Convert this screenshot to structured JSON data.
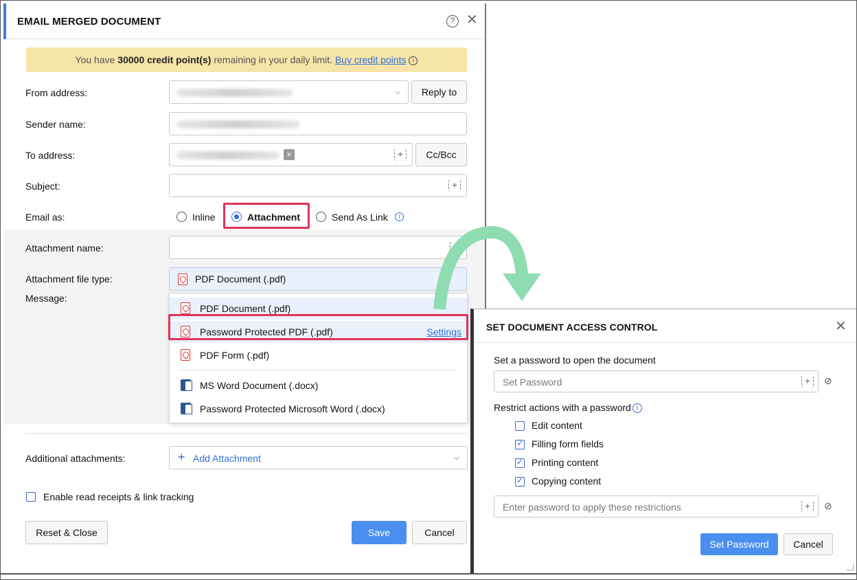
{
  "email_dialog": {
    "title": "EMAIL MERGED DOCUMENT",
    "credit": {
      "prefix": "You have ",
      "amount": "30000 credit point(s)",
      "suffix": " remaining in your daily limit. ",
      "link": "Buy credit points"
    },
    "from_label": "From address:",
    "reply_to": "Reply to",
    "sender_label": "Sender name:",
    "to_label": "To address:",
    "cc_bcc": "Cc/Bcc",
    "subject_label": "Subject:",
    "email_as_label": "Email as:",
    "email_as_options": [
      "Inline",
      "Attachment",
      "Send As Link"
    ],
    "email_as_selected": "Attachment",
    "attachment_name_label": "Attachment name:",
    "file_type_label": "Attachment file type:",
    "file_type_selected": "PDF Document (.pdf)",
    "message_label": "Message:",
    "file_type_options": [
      "PDF Document (.pdf)",
      "Password Protected PDF (.pdf)",
      "PDF Form (.pdf)",
      "MS Word Document (.docx)",
      "Password Protected Microsoft Word (.docx)"
    ],
    "settings_link": "Settings",
    "additional_label": "Additional attachments:",
    "add_attachment": "Add Attachment",
    "read_receipts": "Enable read receipts & link tracking",
    "reset_close": "Reset & Close",
    "save": "Save",
    "cancel": "Cancel"
  },
  "access_dialog": {
    "title": "SET DOCUMENT ACCESS CONTROL",
    "open_label": "Set a password to open the document",
    "set_password_placeholder": "Set Password",
    "restrict_label": "Restrict actions with a password",
    "restrictions": [
      {
        "label": "Edit content",
        "checked": false
      },
      {
        "label": "Filling form fields",
        "checked": true
      },
      {
        "label": "Printing content",
        "checked": true
      },
      {
        "label": "Copying content",
        "checked": true
      }
    ],
    "restrict_placeholder": "Enter password to apply these restrictions",
    "set_password_button": "Set Password",
    "cancel": "Cancel"
  },
  "colors": {
    "accent": "#3b7de0",
    "primary_button": "#4a8fef",
    "highlight": "#e0315a",
    "banner": "#f7e4a8",
    "arrow": "#8fdcb0"
  }
}
